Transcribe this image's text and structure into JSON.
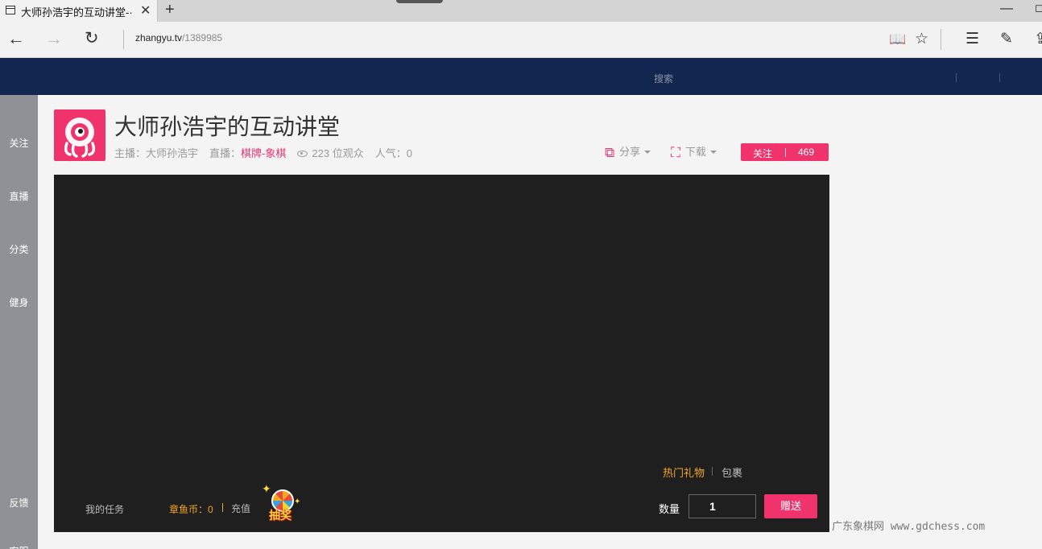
{
  "browser": {
    "tab_title": "大师孙浩宇的互动讲堂-·",
    "tab_close": "✕",
    "new_tab": "+",
    "minimize": "—",
    "restore": "◻",
    "back": "←",
    "forward": "→",
    "reload": "↻",
    "url_host": "zhangyu.tv",
    "url_path": "/1389985",
    "reading_view": "📖",
    "favorite": "☆",
    "hub": "☰",
    "web_note": "✎",
    "share": "⇪"
  },
  "header": {
    "search_label": "搜索"
  },
  "sidebar": {
    "items": [
      "关注",
      "直播",
      "分类",
      "健身",
      "反馈",
      "客服"
    ]
  },
  "room": {
    "title": "大师孙浩宇的互动讲堂",
    "host_label": "主播：",
    "host_name": "大师孙浩宇",
    "live_label": "直播：",
    "category": "棋牌-象棋",
    "viewers": "223 位观众",
    "popularity": "人气：0",
    "share_label": "分享",
    "download_label": "下载",
    "follow_label": "关注",
    "follow_count": "469"
  },
  "player": {
    "gift_tab_hot": "热门礼物",
    "gift_tab_bag": "包裹",
    "my_tasks": "我的任务",
    "coins": "章鱼币：0",
    "recharge": "充值",
    "lottery": "抽奖",
    "qty_label": "数量",
    "qty_value": "1",
    "send_label": "赠送"
  },
  "watermark": "广东象棋网 www.gdchess.com",
  "colors": {
    "accent_pink": "#f0336d",
    "header_navy": "#12274f",
    "coin_orange": "#f5a623"
  }
}
